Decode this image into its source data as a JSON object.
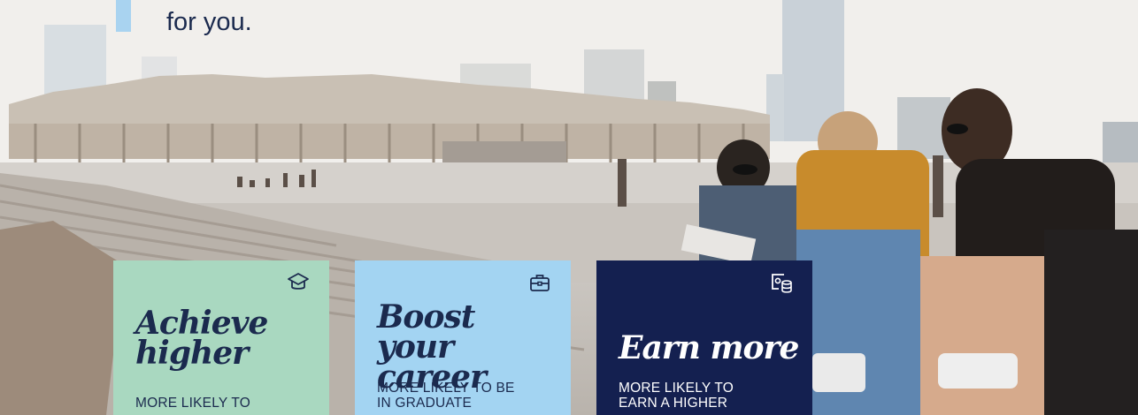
{
  "hero": {
    "headline_visible": "for you."
  },
  "cards": [
    {
      "title_line1": "Achieve",
      "title_line2": "higher",
      "description": "MORE LIKELY TO",
      "icon": "graduation-cap-icon",
      "color": "#a9d8c0"
    },
    {
      "title_line1": "Boost",
      "title_line2": "your career",
      "description_line1": "MORE LIKELY TO BE",
      "description_line2": "IN GRADUATE",
      "icon": "briefcase-icon",
      "color": "#a3d4f2"
    },
    {
      "title_line1": "Earn more",
      "description_line1": "MORE LIKELY TO",
      "description_line2": "EARN A HIGHER",
      "icon": "certificate-coins-icon",
      "color": "#142050"
    }
  ]
}
